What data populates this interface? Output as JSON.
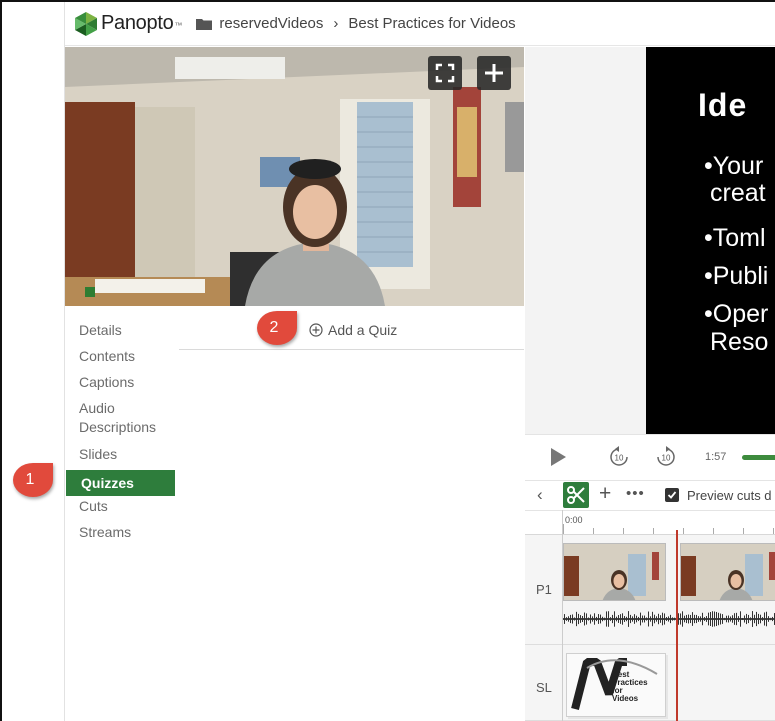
{
  "header": {
    "logo_text": "Panopto",
    "logo_mark": "™",
    "breadcrumb": [
      "reservedVideos",
      "Best Practices for Videos"
    ],
    "separator": "›"
  },
  "slide": {
    "title": "Ide",
    "lines": [
      "•Your",
      "creat",
      "•Toml",
      "•Publi",
      "•Oper",
      "Reso"
    ]
  },
  "menu": {
    "items": [
      {
        "label": "Details"
      },
      {
        "label": "Contents"
      },
      {
        "label": "Captions"
      },
      {
        "label": "Audio Descriptions"
      },
      {
        "label": "Slides"
      },
      {
        "label": "Quizzes",
        "active": true
      },
      {
        "label": "Cuts"
      },
      {
        "label": "Streams"
      }
    ]
  },
  "quiz": {
    "add_label": "Add a Quiz"
  },
  "badges": [
    "1",
    "2"
  ],
  "playback": {
    "skip_back": "10",
    "skip_forward": "10",
    "time": "1:57"
  },
  "editor": {
    "preview_label": "Preview cuts d",
    "preview_checked": true,
    "ruler_start": "0:00",
    "tracks": [
      {
        "label": "P1"
      },
      {
        "label": "SL",
        "thumb_text": [
          "Best",
          "Practices",
          "for",
          "Videos"
        ]
      }
    ]
  },
  "colors": {
    "accent_green": "#2e7d3c",
    "badge_red": "#e14a3c",
    "playhead_red": "#c0392b",
    "slide_bg": "#000000"
  },
  "icons": [
    "panopto-logo-icon",
    "folder-icon",
    "fullscreen-icon",
    "add-icon",
    "add-circle-icon",
    "play-icon",
    "rewind-10-icon",
    "forward-10-icon",
    "back-chevron-icon",
    "scissors-icon",
    "plus-icon",
    "more-icon",
    "checkbox-icon"
  ]
}
